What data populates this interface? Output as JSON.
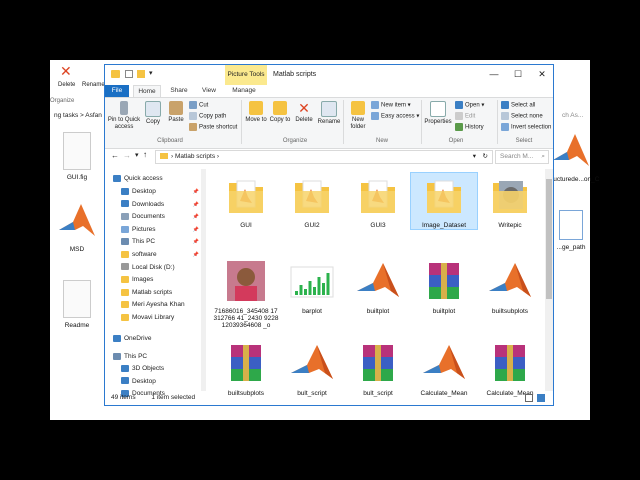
{
  "background_window": {
    "toolbar": {
      "delete_label": "Delete",
      "rename_label": "Rename"
    },
    "organize_label": "Organize",
    "breadcrumb": "ng tasks  >  Asfan",
    "left_files": [
      "GUI.fig",
      "MSD",
      "Readme"
    ],
    "right_files": [
      "structurede...on_C",
      "...ge_path"
    ],
    "search_fragment": "ch As..."
  },
  "window": {
    "title": "Matlab scripts",
    "context_tab_group": "Picture Tools",
    "controls": {
      "minimize": "—",
      "maximize": "☐",
      "close": "✕"
    },
    "tabs": [
      "File",
      "Home",
      "Share",
      "View",
      "Manage"
    ],
    "active_tab": "Home"
  },
  "ribbon": {
    "clipboard": {
      "label": "Clipboard",
      "pin": "Pin to Quick access",
      "copy": "Copy",
      "paste": "Paste",
      "cut": "Cut",
      "copy_path": "Copy path",
      "paste_shortcut": "Paste shortcut"
    },
    "organize": {
      "label": "Organize",
      "move_to": "Move to",
      "copy_to": "Copy to",
      "delete": "Delete",
      "rename": "Rename"
    },
    "new": {
      "label": "New",
      "new_folder": "New folder",
      "new_item": "New item",
      "easy_access": "Easy access"
    },
    "open": {
      "label": "Open",
      "properties": "Properties",
      "open": "Open",
      "edit": "Edit",
      "history": "History"
    },
    "select": {
      "label": "Select",
      "select_all": "Select all",
      "select_none": "Select none",
      "invert": "Invert selection"
    }
  },
  "address": {
    "path": "Matlab scripts",
    "search_placeholder": "Search M..."
  },
  "nav": {
    "quick_access": "Quick access",
    "items": [
      "Desktop",
      "Downloads",
      "Documents",
      "Pictures",
      "This PC",
      "software",
      "Local Disk (D:)",
      "Images",
      "Matlab scripts",
      "Meri Ayesha Khan",
      "Movavi Library"
    ],
    "onedrive": "OneDrive",
    "this_pc": "This PC",
    "pc_items": [
      "3D Objects",
      "Desktop",
      "Documents"
    ]
  },
  "files": [
    {
      "name": "GUI",
      "kind": "folder"
    },
    {
      "name": "GUI2",
      "kind": "folder"
    },
    {
      "name": "GUI3",
      "kind": "folder"
    },
    {
      "name": "Image_Dataset",
      "kind": "folder",
      "selected": true
    },
    {
      "name": "Writepic",
      "kind": "folder-cat"
    },
    {
      "name": "71686016_345408 17312766 41_2430 922812039364608 _o",
      "kind": "photo"
    },
    {
      "name": "barplot",
      "kind": "plot"
    },
    {
      "name": "builtplot",
      "kind": "matlab"
    },
    {
      "name": "builtplot",
      "kind": "archive"
    },
    {
      "name": "builtsubplots",
      "kind": "matlab"
    },
    {
      "name": "builtsubplots",
      "kind": "archive"
    },
    {
      "name": "bult_script",
      "kind": "matlab"
    },
    {
      "name": "bult_script",
      "kind": "archive"
    },
    {
      "name": "Calculate_Mean",
      "kind": "matlab"
    },
    {
      "name": "Calculate_Mean",
      "kind": "archive"
    }
  ],
  "status": {
    "count": "49 items",
    "selected": "1 item selected"
  },
  "colors": {
    "accent": "#2b79d0",
    "folder": "#f5c342",
    "matlab": "#e8702a",
    "selection": "#cce8ff"
  }
}
